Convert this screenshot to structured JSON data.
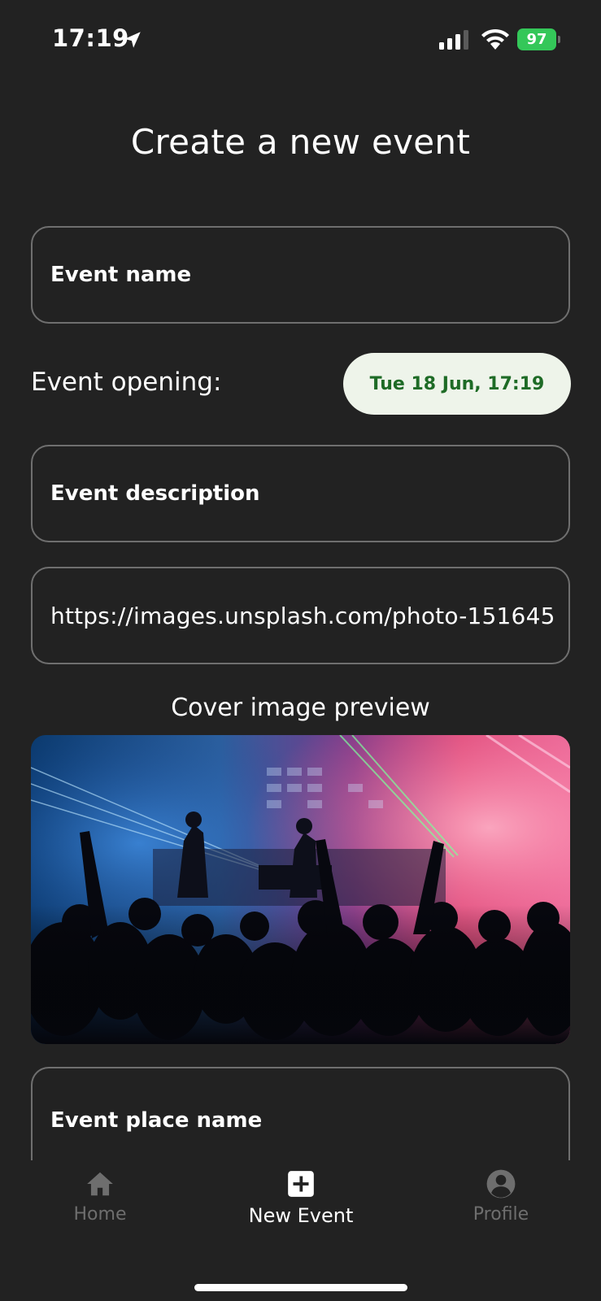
{
  "status_bar": {
    "time": "17:19",
    "battery": "97"
  },
  "page": {
    "title": "Create a new event"
  },
  "form": {
    "event_name_label": "Event name",
    "event_opening_label": "Event opening:",
    "event_opening_value": "Tue 18 Jun, 17:19",
    "event_description_label": "Event description",
    "cover_url_value": "https://images.unsplash.com/photo-151645",
    "cover_preview_caption": "Cover image preview",
    "event_place_label": "Event place name"
  },
  "tab_bar": {
    "tabs": [
      {
        "label": "Home",
        "icon": "home-icon",
        "active": false
      },
      {
        "label": "New Event",
        "icon": "plus-square-icon",
        "active": true
      },
      {
        "label": "Profile",
        "icon": "user-circle-icon",
        "active": false
      }
    ]
  },
  "colors": {
    "background": "#222222",
    "field_border": "#6f6f6f",
    "pill_bg": "#eef4ea",
    "pill_text": "#1e6b26",
    "battery": "#34c759",
    "inactive_tab": "#6e6e6e"
  }
}
